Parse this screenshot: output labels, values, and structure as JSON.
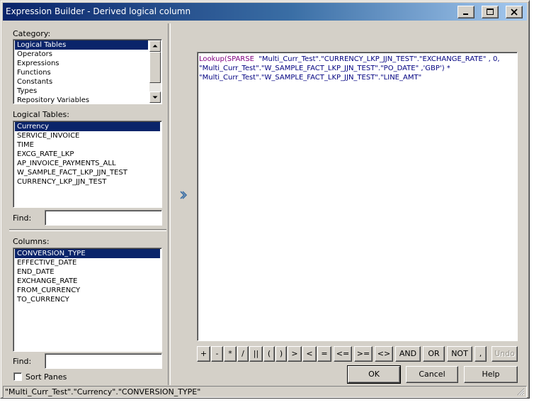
{
  "window": {
    "title": "Expression Builder - Derived logical column"
  },
  "category": {
    "label": "Category:",
    "items": [
      "Logical Tables",
      "Operators",
      "Expressions",
      "Functions",
      "Constants",
      "Types",
      "Repository Variables"
    ],
    "selected": 0
  },
  "logical_tables": {
    "label": "Logical Tables:",
    "items": [
      "Currency",
      "SERVICE_INVOICE",
      "TIME",
      "EXCG_RATE_LKP",
      "AP_INVOICE_PAYMENTS_ALL",
      "W_SAMPLE_FACT_LKP_JJN_TEST",
      "CURRENCY_LKP_JJN_TEST"
    ],
    "selected": 0
  },
  "find_top": {
    "label": "Find:",
    "value": ""
  },
  "columns": {
    "label": "Columns:",
    "items": [
      "CONVERSION_TYPE",
      "EFFECTIVE_DATE",
      "END_DATE",
      "EXCHANGE_RATE",
      "FROM_CURRENCY",
      "TO_CURRENCY"
    ],
    "selected": 0
  },
  "find_bottom": {
    "label": "Find:",
    "value": ""
  },
  "sort_panes": {
    "label": "Sort Panes",
    "checked": false
  },
  "expression": {
    "kw_lookup": "Lookup",
    "kw_open": "(",
    "kw_sparse": "SPARSE",
    "line1_rest": "  \"Multi_Curr_Test\".\"CURRENCY_LKP_JJN_TEST\".\"EXCHANGE_RATE\" , 0,",
    "line2": "\"Multi_Curr_Test\".\"W_SAMPLE_FACT_LKP_JJN_TEST\".\"PO_DATE\" ,'GBP') *",
    "line3": "\"Multi_Curr_Test\".\"W_SAMPLE_FACT_LKP_JJN_TEST\".\"LINE_AMT\""
  },
  "operators": {
    "plus": "+",
    "minus": "-",
    "times": "*",
    "divide": "/",
    "concat": "||",
    "lparen": "(",
    "rparen": ")",
    "gt": ">",
    "lt": "<",
    "eq": "=",
    "le": "<=",
    "ge": ">=",
    "ne": "<>",
    "and": "AND",
    "or": "OR",
    "not": "NOT",
    "comma": ",",
    "undo": "Undo"
  },
  "buttons": {
    "ok": "OK",
    "cancel": "Cancel",
    "help": "Help"
  },
  "status": {
    "text": "\"Multi_Curr_Test\".\"Currency\".\"CONVERSION_TYPE\""
  },
  "colors": {
    "selection": "#0a246a",
    "keyword": "#800080",
    "expression_text": "#000080",
    "face": "#d4d0c8"
  },
  "icons": {
    "minimize": "minimize-icon",
    "maximize": "maximize-icon",
    "close": "close-icon",
    "scroll_up": "arrow-up-icon",
    "scroll_down": "arrow-down-icon",
    "toggle": "double-chevron-right-icon",
    "resize": "resize-grip-icon"
  }
}
